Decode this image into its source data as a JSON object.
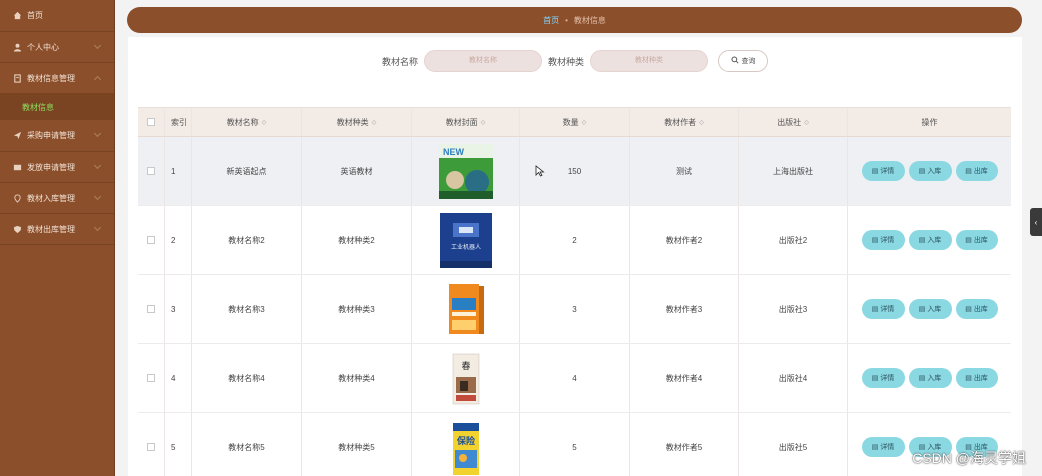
{
  "sidebar": {
    "home": "首页",
    "personal": "个人中心",
    "textbook_mgmt": "教材信息管理",
    "textbook_info": "教材信息",
    "purchase_mgmt": "采购申请管理",
    "issue_mgmt": "发放申请管理",
    "in_mgmt": "教材入库管理",
    "out_mgmt": "教材出库管理"
  },
  "breadcrumb": {
    "home": "首页",
    "separator": "•",
    "current": "教材信息"
  },
  "search": {
    "name_label": "教材名称",
    "name_placeholder": "教材名称",
    "type_label": "教材种类",
    "type_placeholder": "教材种类",
    "query_button": "查询"
  },
  "table": {
    "headers": {
      "index": "索引",
      "name": "教材名称",
      "type": "教材种类",
      "cover": "教材封面",
      "quantity": "数量",
      "author": "教材作者",
      "publisher": "出版社",
      "actions": "操作"
    },
    "sort_glyph": "◇",
    "rows": [
      {
        "index": "1",
        "name": "新英语起点",
        "type": "英语教材",
        "quantity": "150",
        "author": "测试",
        "publisher": "上海出版社"
      },
      {
        "index": "2",
        "name": "教材名称2",
        "type": "教材种类2",
        "quantity": "2",
        "author": "教材作者2",
        "publisher": "出版社2"
      },
      {
        "index": "3",
        "name": "教材名称3",
        "type": "教材种类3",
        "quantity": "3",
        "author": "教材作者3",
        "publisher": "出版社3"
      },
      {
        "index": "4",
        "name": "教材名称4",
        "type": "教材种类4",
        "quantity": "4",
        "author": "教材作者4",
        "publisher": "出版社4"
      },
      {
        "index": "5",
        "name": "教材名称5",
        "type": "教材种类5",
        "quantity": "5",
        "author": "教材作者5",
        "publisher": "出版社5"
      }
    ],
    "actions": {
      "detail": "详情",
      "in": "入库",
      "out": "出库"
    }
  },
  "cover_labels": {
    "cover1": "NEW",
    "cover2": "工业机器人",
    "cover4": "春",
    "cover5": "保险"
  },
  "watermark": "CSDN @海灵学姐",
  "colors": {
    "sidebar": "#8c4f2b",
    "active_submenu": "#8ee05e",
    "action_button": "#8ad8e2",
    "header_row": "#f3ebe6"
  }
}
